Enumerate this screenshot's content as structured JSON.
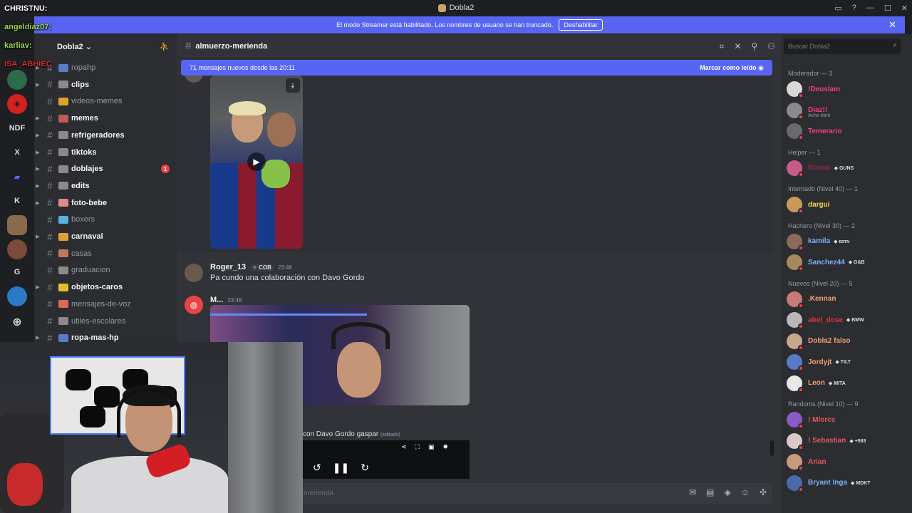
{
  "window": {
    "title": "Dobla2"
  },
  "banner": {
    "text": "El modo Streamer está habilitado. Los nombres de usuario se han truncado.",
    "button": "Deshabilitar"
  },
  "guilds": [
    "NDF",
    "X",
    "K",
    "G"
  ],
  "server": {
    "name": "Dobla2"
  },
  "channels": [
    {
      "label": "ropahp",
      "unread": false,
      "caret": true
    },
    {
      "label": "clips",
      "unread": true,
      "caret": true
    },
    {
      "label": "videos-memes",
      "unread": false,
      "caret": false
    },
    {
      "label": "memes",
      "unread": true,
      "caret": true
    },
    {
      "label": "refrigeradores",
      "unread": true,
      "caret": true
    },
    {
      "label": "tiktoks",
      "unread": true,
      "caret": true
    },
    {
      "label": "doblajes",
      "unread": true,
      "caret": true,
      "badge": "1"
    },
    {
      "label": "edits",
      "unread": true,
      "caret": true
    },
    {
      "label": "foto-bebe",
      "unread": true,
      "caret": true
    },
    {
      "label": "boxers",
      "unread": false,
      "caret": false
    },
    {
      "label": "carnaval",
      "unread": true,
      "caret": true
    },
    {
      "label": "casas",
      "unread": false,
      "caret": false
    },
    {
      "label": "graduacion",
      "unread": false,
      "caret": false
    },
    {
      "label": "objetos-caros",
      "unread": true,
      "caret": true
    },
    {
      "label": "mensajes-de-voz",
      "unread": false,
      "caret": false
    },
    {
      "label": "utiles-escolares",
      "unread": false,
      "caret": false
    },
    {
      "label": "ropa-mas-hp",
      "unread": true,
      "caret": true
    }
  ],
  "chat": {
    "channel_name": "almuerzo-merienda",
    "new_messages": "71 mensajes nuevos desde las 20:11",
    "mark_read": "Marcar como leído",
    "messages": [
      {
        "author": "Roger_13",
        "tag": "COB",
        "time": "23:48",
        "text": "Pa cundo una colaboración con Davo Gordo"
      },
      {
        "author": "M...",
        "time": "23:48"
      }
    ],
    "edited_text": "con Davo Gordo gaspar",
    "edited_label": "(editado)",
    "composer_placeholder": "merienda"
  },
  "members": {
    "search_placeholder": "Buscar Dobla2",
    "groups": [
      {
        "title": "Moderador — 3",
        "items": [
          {
            "name": "!Deuslam",
            "color": "#f23f7a"
          },
          {
            "name": "Diaz!!",
            "color": "#f23f7a",
            "sub": "Acho kbrn"
          },
          {
            "name": "Temerario",
            "color": "#f23f7a"
          }
        ]
      },
      {
        "title": "Helper — 1",
        "items": [
          {
            "name": "Noooo",
            "color": "#8a2a4a",
            "tag": "GUNS"
          }
        ]
      },
      {
        "title": "Internado (Nivel 40) — 1",
        "items": [
          {
            "name": "dargui",
            "color": "#f0d94a"
          }
        ]
      },
      {
        "title": "Hachero (Nivel 30) — 2",
        "items": [
          {
            "name": "kamila",
            "color": "#7bb0ff",
            "tag": "ʙɪᴛɴ"
          },
          {
            "name": "Sanchez44",
            "color": "#7bb0ff",
            "tag": "G&B"
          }
        ]
      },
      {
        "title": "Nuevos (Nivel 20) — 5",
        "items": [
          {
            "name": ".Kennan",
            "color": "#f0a070"
          },
          {
            "name": "abel_dose",
            "color": "#e0303a",
            "tag": "BMW"
          },
          {
            "name": "Dobla2 falso",
            "color": "#f0a070"
          },
          {
            "name": "Jordyjt",
            "color": "#f0a070",
            "tag": "TILT"
          },
          {
            "name": "Leon",
            "color": "#f0a070",
            "tag": "MITA"
          }
        ]
      },
      {
        "title": "Randoms (Nivel 10) — 9",
        "items": [
          {
            "name": "! Mlorcs",
            "color": "#e05a5a"
          },
          {
            "name": "! Sebastian",
            "color": "#e05a5a",
            "tag": "+593"
          },
          {
            "name": "Arian",
            "color": "#e05a5a"
          },
          {
            "name": "Bryant Inga",
            "color": "#7bb0ff",
            "tag": "MDKT"
          }
        ]
      }
    ]
  },
  "stream_chat": [
    {
      "user": "CHRISTNU:",
      "color": "#ffffff"
    },
    {
      "user": "angeldiaz07:",
      "color": "#9bd84a"
    },
    {
      "user": "karliav:",
      "color": "#9bd84a"
    },
    {
      "user": "ISA_ABHIEC:",
      "color": "#d03030"
    }
  ]
}
